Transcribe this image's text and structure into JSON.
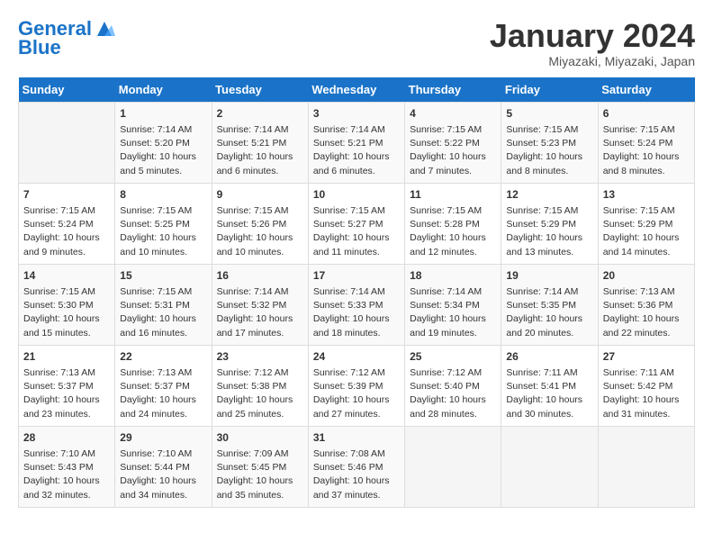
{
  "header": {
    "logo_line1": "General",
    "logo_line2": "Blue",
    "month_title": "January 2024",
    "location": "Miyazaki, Miyazaki, Japan"
  },
  "weekdays": [
    "Sunday",
    "Monday",
    "Tuesday",
    "Wednesday",
    "Thursday",
    "Friday",
    "Saturday"
  ],
  "weeks": [
    [
      {
        "day": "",
        "info": ""
      },
      {
        "day": "1",
        "info": "Sunrise: 7:14 AM\nSunset: 5:20 PM\nDaylight: 10 hours\nand 5 minutes."
      },
      {
        "day": "2",
        "info": "Sunrise: 7:14 AM\nSunset: 5:21 PM\nDaylight: 10 hours\nand 6 minutes."
      },
      {
        "day": "3",
        "info": "Sunrise: 7:14 AM\nSunset: 5:21 PM\nDaylight: 10 hours\nand 6 minutes."
      },
      {
        "day": "4",
        "info": "Sunrise: 7:15 AM\nSunset: 5:22 PM\nDaylight: 10 hours\nand 7 minutes."
      },
      {
        "day": "5",
        "info": "Sunrise: 7:15 AM\nSunset: 5:23 PM\nDaylight: 10 hours\nand 8 minutes."
      },
      {
        "day": "6",
        "info": "Sunrise: 7:15 AM\nSunset: 5:24 PM\nDaylight: 10 hours\nand 8 minutes."
      }
    ],
    [
      {
        "day": "7",
        "info": "Sunrise: 7:15 AM\nSunset: 5:24 PM\nDaylight: 10 hours\nand 9 minutes."
      },
      {
        "day": "8",
        "info": "Sunrise: 7:15 AM\nSunset: 5:25 PM\nDaylight: 10 hours\nand 10 minutes."
      },
      {
        "day": "9",
        "info": "Sunrise: 7:15 AM\nSunset: 5:26 PM\nDaylight: 10 hours\nand 10 minutes."
      },
      {
        "day": "10",
        "info": "Sunrise: 7:15 AM\nSunset: 5:27 PM\nDaylight: 10 hours\nand 11 minutes."
      },
      {
        "day": "11",
        "info": "Sunrise: 7:15 AM\nSunset: 5:28 PM\nDaylight: 10 hours\nand 12 minutes."
      },
      {
        "day": "12",
        "info": "Sunrise: 7:15 AM\nSunset: 5:29 PM\nDaylight: 10 hours\nand 13 minutes."
      },
      {
        "day": "13",
        "info": "Sunrise: 7:15 AM\nSunset: 5:29 PM\nDaylight: 10 hours\nand 14 minutes."
      }
    ],
    [
      {
        "day": "14",
        "info": "Sunrise: 7:15 AM\nSunset: 5:30 PM\nDaylight: 10 hours\nand 15 minutes."
      },
      {
        "day": "15",
        "info": "Sunrise: 7:15 AM\nSunset: 5:31 PM\nDaylight: 10 hours\nand 16 minutes."
      },
      {
        "day": "16",
        "info": "Sunrise: 7:14 AM\nSunset: 5:32 PM\nDaylight: 10 hours\nand 17 minutes."
      },
      {
        "day": "17",
        "info": "Sunrise: 7:14 AM\nSunset: 5:33 PM\nDaylight: 10 hours\nand 18 minutes."
      },
      {
        "day": "18",
        "info": "Sunrise: 7:14 AM\nSunset: 5:34 PM\nDaylight: 10 hours\nand 19 minutes."
      },
      {
        "day": "19",
        "info": "Sunrise: 7:14 AM\nSunset: 5:35 PM\nDaylight: 10 hours\nand 20 minutes."
      },
      {
        "day": "20",
        "info": "Sunrise: 7:13 AM\nSunset: 5:36 PM\nDaylight: 10 hours\nand 22 minutes."
      }
    ],
    [
      {
        "day": "21",
        "info": "Sunrise: 7:13 AM\nSunset: 5:37 PM\nDaylight: 10 hours\nand 23 minutes."
      },
      {
        "day": "22",
        "info": "Sunrise: 7:13 AM\nSunset: 5:37 PM\nDaylight: 10 hours\nand 24 minutes."
      },
      {
        "day": "23",
        "info": "Sunrise: 7:12 AM\nSunset: 5:38 PM\nDaylight: 10 hours\nand 25 minutes."
      },
      {
        "day": "24",
        "info": "Sunrise: 7:12 AM\nSunset: 5:39 PM\nDaylight: 10 hours\nand 27 minutes."
      },
      {
        "day": "25",
        "info": "Sunrise: 7:12 AM\nSunset: 5:40 PM\nDaylight: 10 hours\nand 28 minutes."
      },
      {
        "day": "26",
        "info": "Sunrise: 7:11 AM\nSunset: 5:41 PM\nDaylight: 10 hours\nand 30 minutes."
      },
      {
        "day": "27",
        "info": "Sunrise: 7:11 AM\nSunset: 5:42 PM\nDaylight: 10 hours\nand 31 minutes."
      }
    ],
    [
      {
        "day": "28",
        "info": "Sunrise: 7:10 AM\nSunset: 5:43 PM\nDaylight: 10 hours\nand 32 minutes."
      },
      {
        "day": "29",
        "info": "Sunrise: 7:10 AM\nSunset: 5:44 PM\nDaylight: 10 hours\nand 34 minutes."
      },
      {
        "day": "30",
        "info": "Sunrise: 7:09 AM\nSunset: 5:45 PM\nDaylight: 10 hours\nand 35 minutes."
      },
      {
        "day": "31",
        "info": "Sunrise: 7:08 AM\nSunset: 5:46 PM\nDaylight: 10 hours\nand 37 minutes."
      },
      {
        "day": "",
        "info": ""
      },
      {
        "day": "",
        "info": ""
      },
      {
        "day": "",
        "info": ""
      }
    ]
  ]
}
